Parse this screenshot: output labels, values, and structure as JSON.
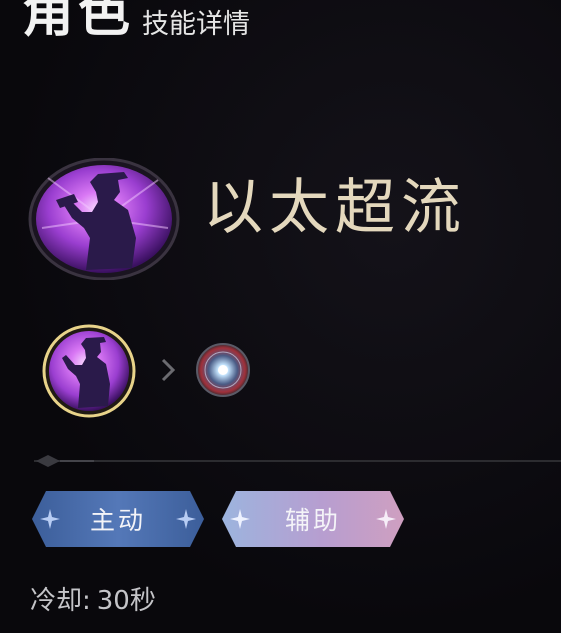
{
  "header": {
    "title": "角色",
    "subtitle": "技能详情"
  },
  "skill": {
    "name": "以太超流",
    "icon": "gunslinger-silhouette-icon",
    "accent_color": "#b455e6"
  },
  "skill_chain": {
    "from_icon": "gunslinger-silhouette-icon",
    "arrow_icon": "chevron-right-icon",
    "to_icon": "ether-orb-icon"
  },
  "tags": [
    {
      "label": "主动",
      "color": "#4a6aa8"
    },
    {
      "label": "辅助",
      "color": "#b7a6d6"
    }
  ],
  "cooldown": {
    "label": "冷却:",
    "value": "30秒"
  }
}
